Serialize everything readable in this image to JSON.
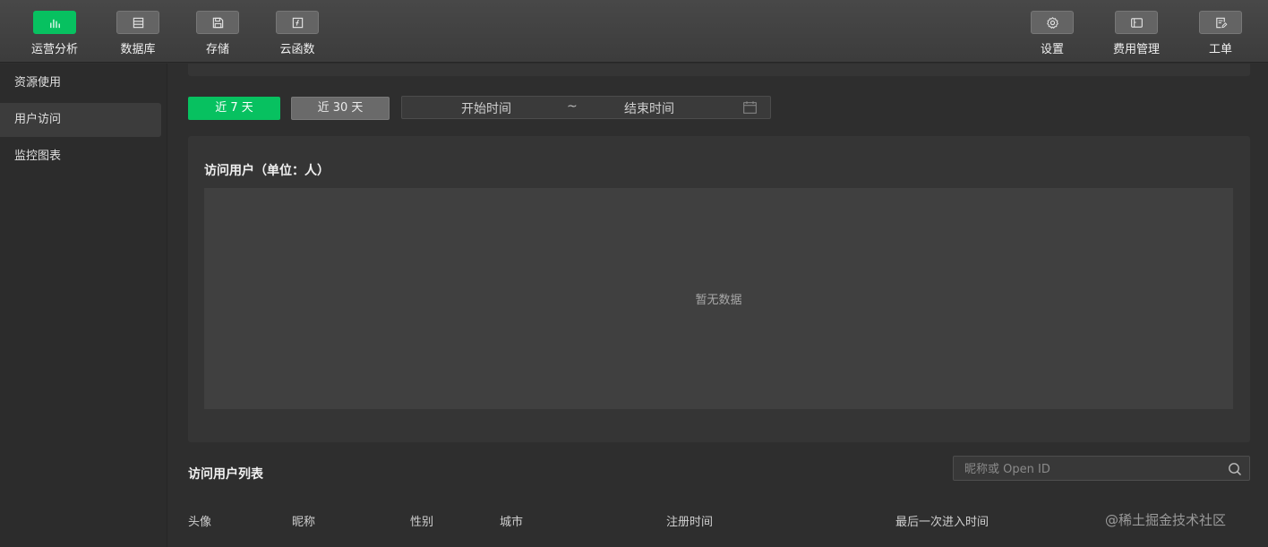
{
  "toolbar": {
    "left": [
      {
        "label": "运营分析",
        "icon": "bar-chart-icon",
        "active": true
      },
      {
        "label": "数据库",
        "icon": "database-icon",
        "active": false
      },
      {
        "label": "存储",
        "icon": "storage-icon",
        "active": false
      },
      {
        "label": "云函数",
        "icon": "function-icon",
        "active": false
      }
    ],
    "right": [
      {
        "label": "设置",
        "icon": "gear-icon"
      },
      {
        "label": "费用管理",
        "icon": "billing-icon"
      },
      {
        "label": "工单",
        "icon": "ticket-icon"
      }
    ]
  },
  "sidebar": {
    "items": [
      {
        "label": "资源使用",
        "active": false
      },
      {
        "label": "用户访问",
        "active": true
      },
      {
        "label": "监控图表",
        "active": false
      }
    ]
  },
  "filters": {
    "range_7": "近 7 天",
    "range_30": "近 30 天",
    "start_placeholder": "开始时间",
    "separator": "~",
    "end_placeholder": "结束时间"
  },
  "chart": {
    "title": "访问用户（单位：人）",
    "empty_text": "暂无数据"
  },
  "list": {
    "title": "访问用户列表",
    "search_placeholder": "昵称或 Open ID",
    "columns": [
      "头像",
      "昵称",
      "性别",
      "城市",
      "注册时间",
      "最后一次进入时间"
    ]
  },
  "watermark": "@稀土掘金技术社区",
  "colors": {
    "accent": "#07c160",
    "background": "#2e2e2e",
    "panel": "#353535"
  }
}
